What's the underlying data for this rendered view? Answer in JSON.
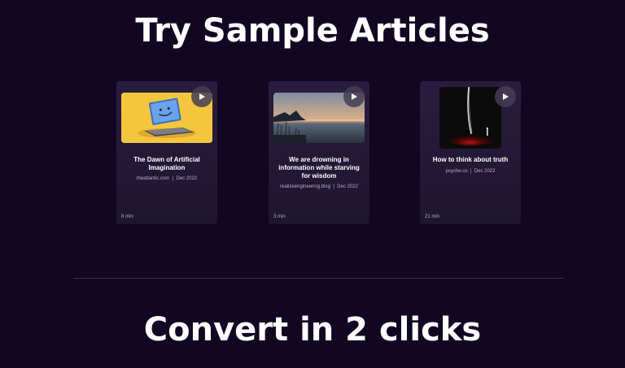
{
  "sections": {
    "sample_title": "Try Sample Articles",
    "convert_title": "Convert in 2 clicks"
  },
  "articles": [
    {
      "title": "The Dawn of Artificial Imagination",
      "source": "theatlantic.com",
      "separator": "|",
      "date": "Dec 2022",
      "duration": "8 min",
      "thumbnail": "laptop-smiley-image",
      "play_icon": "play-icon"
    },
    {
      "title": "We are drowning in information while starving for wisdom",
      "source": "realizeengineering.blog",
      "separator": "|",
      "date": "Dec 2022",
      "duration": "3 min",
      "thumbnail": "lake-sunset-image",
      "play_icon": "play-icon"
    },
    {
      "title": "How to think about truth",
      "source": "psyche.co",
      "separator": "|",
      "date": "Dec 2022",
      "duration": "21 min",
      "thumbnail": "dark-spotlight-image",
      "play_icon": "play-icon"
    }
  ],
  "colors": {
    "background": "#120722",
    "card_background": "#2a1c3e",
    "divider": "#3a2e4c",
    "meta_text": "#b6aec4"
  }
}
